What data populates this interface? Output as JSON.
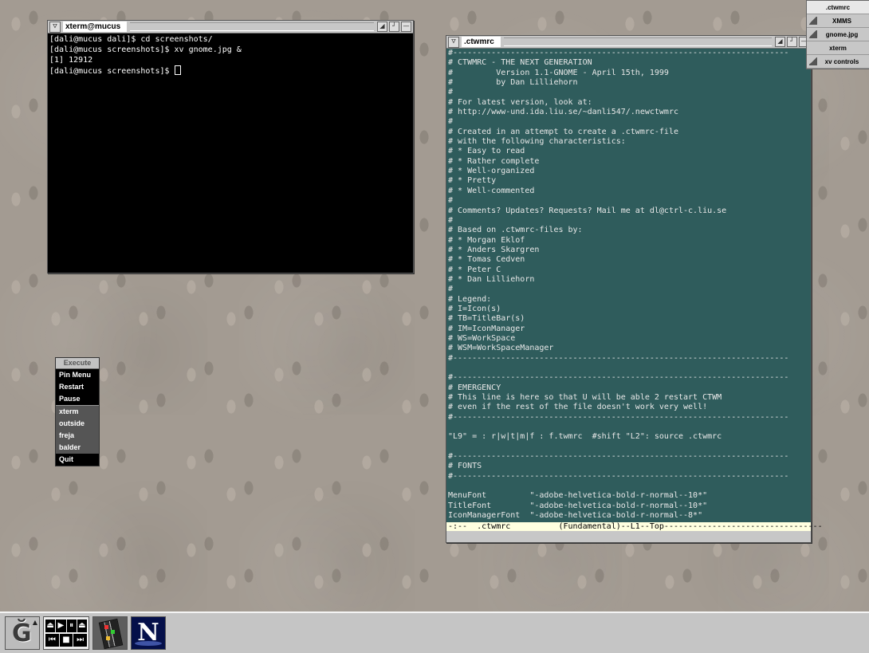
{
  "xterm": {
    "title": "xterm@mucus",
    "lines": [
      "[dali@mucus dali]$ cd screenshots/",
      "[dali@mucus screenshots]$ xv gnome.jpg &",
      "[1] 12912",
      "[dali@mucus screenshots]$ "
    ]
  },
  "emacs": {
    "title": ".ctwmrc",
    "lines": [
      "#----------------------------------------------------------------------",
      "# CTWMRC - THE NEXT GENERATION",
      "#         Version 1.1-GNOME - April 15th, 1999",
      "#         by Dan Lilliehorn",
      "#",
      "# For latest version, look at:",
      "# http://www-und.ida.liu.se/~danli547/.newctwmrc",
      "#",
      "# Created in an attempt to create a .ctwmrc-file",
      "# with the following characteristics:",
      "# * Easy to read",
      "# * Rather complete",
      "# * Well-organized",
      "# * Pretty",
      "# * Well-commented",
      "#",
      "# Comments? Updates? Requests? Mail me at dl@ctrl-c.liu.se",
      "#",
      "# Based on .ctwmrc-files by:",
      "# * Morgan Eklof",
      "# * Anders Skargren",
      "# * Tomas Cedven",
      "# * Peter C",
      "# * Dan Lilliehorn",
      "#",
      "# Legend:",
      "# I=Icon(s)",
      "# TB=TitleBar(s)",
      "# IM=IconManager",
      "# WS=WorkSpace",
      "# WSM=WorkSpaceManager",
      "#----------------------------------------------------------------------",
      "",
      "#----------------------------------------------------------------------",
      "# EMERGENCY",
      "# This line is here so that U will be able 2 restart CTWM",
      "# even if the rest of the file doesn't work very well!",
      "#----------------------------------------------------------------------",
      "",
      "\"L9\" = : r|w|t|m|f : f.twmrc  #shift \"L2\": source .ctwmrc",
      "",
      "#----------------------------------------------------------------------",
      "# FONTS",
      "#----------------------------------------------------------------------",
      "",
      "MenuFont         \"-adobe-helvetica-bold-r-normal--10*\"",
      "TitleFont        \"-adobe-helvetica-bold-r-normal--10*\"",
      "IconManagerFont  \"-adobe-helvetica-bold-r-normal--8*\""
    ],
    "modeline": "-:--  .ctwmrc          (Fundamental)--L1--Top---------------------------------"
  },
  "twm_menu": {
    "header": "Execute",
    "group1": [
      "Pin Menu",
      "Restart",
      "Pause"
    ],
    "group2": [
      "xterm",
      "outside",
      "freja",
      "balder"
    ],
    "quit": "Quit"
  },
  "icon_manager": {
    "items": [
      ".ctwmrc",
      "XMMS",
      "gnome.jpg",
      "xterm",
      "xv controls"
    ]
  },
  "panel": {
    "player_top": [
      "⏏",
      "▶",
      "⏸",
      "⏏"
    ],
    "player_bottom": [
      "⏮",
      "■",
      "⏭"
    ],
    "netscape_letter": "N"
  }
}
